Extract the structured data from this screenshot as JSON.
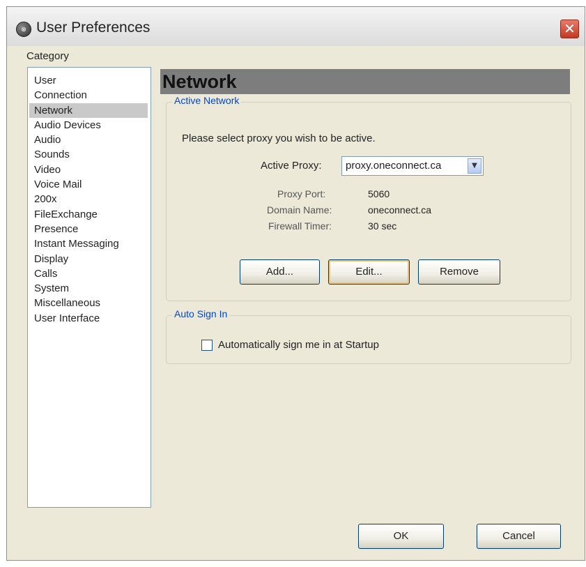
{
  "window": {
    "title": "User Preferences",
    "close_symbol": "✕",
    "icon_text": "⊗"
  },
  "sidebar": {
    "label": "Category",
    "items": [
      {
        "label": "User",
        "selected": false
      },
      {
        "label": "Connection",
        "selected": false
      },
      {
        "label": "Network",
        "selected": true
      },
      {
        "label": "Audio Devices",
        "selected": false
      },
      {
        "label": "Audio",
        "selected": false
      },
      {
        "label": "Sounds",
        "selected": false
      },
      {
        "label": "Video",
        "selected": false
      },
      {
        "label": "Voice Mail",
        "selected": false
      },
      {
        "label": "200x",
        "selected": false
      },
      {
        "label": "FileExchange",
        "selected": false
      },
      {
        "label": "Presence",
        "selected": false
      },
      {
        "label": "Instant Messaging",
        "selected": false
      },
      {
        "label": "Display",
        "selected": false
      },
      {
        "label": "Calls",
        "selected": false
      },
      {
        "label": "System",
        "selected": false
      },
      {
        "label": "Miscellaneous",
        "selected": false
      },
      {
        "label": "User Interface",
        "selected": false
      }
    ]
  },
  "main": {
    "header": "Network",
    "active_network": {
      "legend": "Active Network",
      "instruction": "Please select proxy you wish to be active.",
      "proxy_label": "Active Proxy:",
      "proxy_value": "proxy.oneconnect.ca",
      "details": [
        {
          "label": "Proxy Port:",
          "value": "5060"
        },
        {
          "label": "Domain Name:",
          "value": "oneconnect.ca"
        },
        {
          "label": "Firewall Timer:",
          "value": "30 sec"
        }
      ],
      "buttons": {
        "add": "Add...",
        "edit": "Edit...",
        "remove": "Remove"
      }
    },
    "auto_sign_in": {
      "legend": "Auto Sign In",
      "checkbox_label": "Automatically sign me in at Startup",
      "checked": false
    }
  },
  "footer": {
    "ok": "OK",
    "cancel": "Cancel"
  },
  "colors": {
    "header_bg": "#7d7d7d",
    "selected_item_bg": "#c9c9c9",
    "legend_text": "#0046d5",
    "dialog_bg": "#ece9d8"
  }
}
